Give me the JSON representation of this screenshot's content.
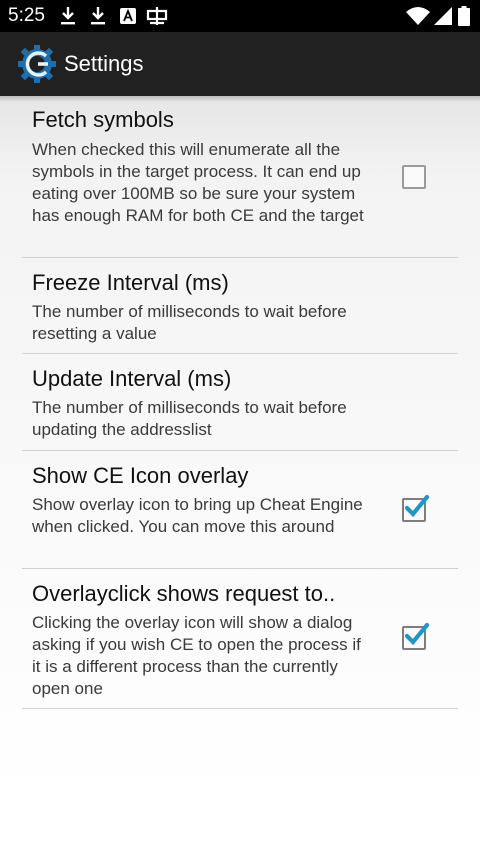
{
  "status_bar": {
    "time": "5:25",
    "left_icons": [
      "download-icon",
      "download-icon",
      "a-notification-icon",
      "keyboard-icon"
    ],
    "right_icons": [
      "wifi-icon",
      "cell-signal-icon",
      "battery-icon"
    ]
  },
  "action_bar": {
    "title": "Settings",
    "logo": "cheat-engine-logo"
  },
  "preferences": [
    {
      "title": "Fetch symbols",
      "summary": "When checked this will enumerate all the symbols in the target process. It can end up eating over 100MB so be sure your system has enough RAM for both CE and the target",
      "checkbox": true,
      "checked": false
    },
    {
      "title": "Freeze Interval (ms)",
      "summary": "The number of milliseconds to wait before resetting a value",
      "checkbox": false
    },
    {
      "title": "Update Interval (ms)",
      "summary": "The number of milliseconds to wait before updating the addresslist",
      "checkbox": false
    },
    {
      "title": "Show CE Icon overlay",
      "summary": "Show overlay icon to bring up Cheat Engine when clicked. You can move this around",
      "checkbox": true,
      "checked": true
    },
    {
      "title": "Overlayclick shows request to..",
      "summary": "Clicking the overlay icon will show a dialog asking if you wish CE to open the process if it is a different process than the currently open one",
      "checkbox": true,
      "checked": true
    }
  ],
  "colors": {
    "accent": "#2196c9",
    "action_bar": "#212121",
    "status_bar": "#000000"
  }
}
